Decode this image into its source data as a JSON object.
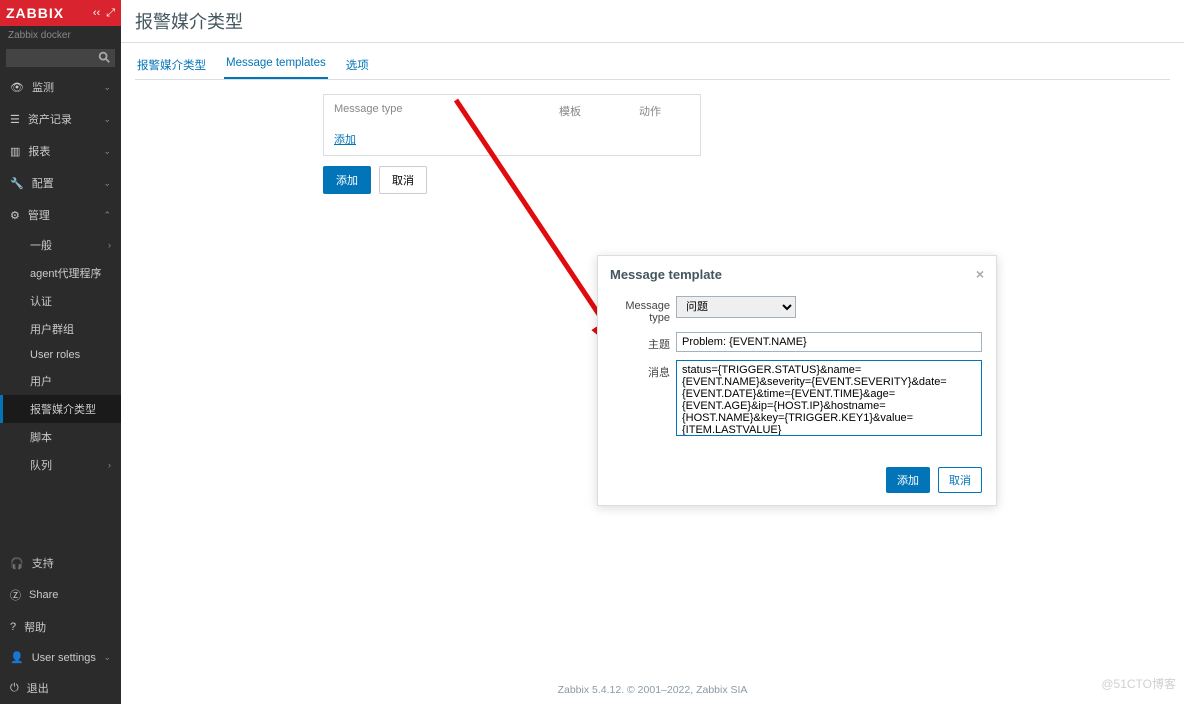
{
  "brand": {
    "logo": "ZABBIX",
    "subtitle": "Zabbix docker"
  },
  "sidebar": {
    "main": [
      {
        "icon": "eye",
        "label": "监测"
      },
      {
        "icon": "list",
        "label": "资产记录"
      },
      {
        "icon": "chart",
        "label": "报表"
      },
      {
        "icon": "wrench",
        "label": "配置"
      },
      {
        "icon": "gear",
        "label": "管理",
        "open": true
      }
    ],
    "admin_sub": [
      {
        "label": "一般",
        "chev": true
      },
      {
        "label": "agent代理程序"
      },
      {
        "label": "认证"
      },
      {
        "label": "用户群组"
      },
      {
        "label": "User roles"
      },
      {
        "label": "用户"
      },
      {
        "label": "报警媒介类型",
        "active": true
      },
      {
        "label": "脚本"
      },
      {
        "label": "队列",
        "chev": true
      }
    ],
    "bottom": [
      {
        "icon": "support",
        "label": "支持"
      },
      {
        "icon": "share",
        "label": "Share"
      },
      {
        "icon": "help",
        "label": "帮助"
      },
      {
        "icon": "user",
        "label": "User settings",
        "chev": true
      },
      {
        "icon": "power",
        "label": "退出"
      }
    ]
  },
  "page": {
    "title": "报警媒介类型"
  },
  "tabs": [
    {
      "label": "报警媒介类型"
    },
    {
      "label": "Message templates",
      "active": true
    },
    {
      "label": "选项"
    }
  ],
  "table": {
    "headers": {
      "type": "Message type",
      "template": "模板",
      "action": "动作"
    },
    "add_link": "添加"
  },
  "actions": {
    "add": "添加",
    "cancel": "取消"
  },
  "modal": {
    "title": "Message template",
    "fields": {
      "type": {
        "label": "Message type",
        "value": "问题"
      },
      "subject": {
        "label": "主题",
        "value": "Problem: {EVENT.NAME}"
      },
      "message": {
        "label": "消息",
        "value": "status={TRIGGER.STATUS}&name={EVENT.NAME}&severity={EVENT.SEVERITY}&date={EVENT.DATE}&time={EVENT.TIME}&age={EVENT.AGE}&ip={HOST.IP}&hostname={HOST.NAME}&key={TRIGGER.KEY1}&value={ITEM.LASTVALUE}"
      }
    },
    "buttons": {
      "add": "添加",
      "cancel": "取消"
    }
  },
  "footer": "Zabbix 5.4.12. © 2001–2022, Zabbix SIA",
  "watermark": "@51CTO博客"
}
